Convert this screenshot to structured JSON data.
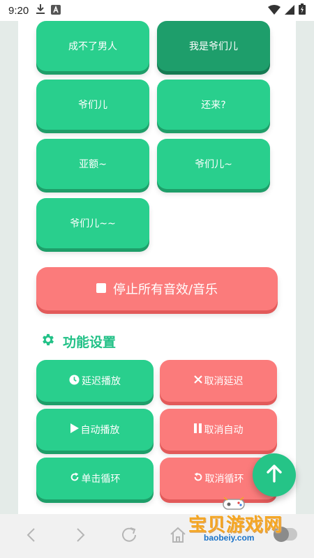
{
  "status_bar": {
    "time": "9:20",
    "icons": [
      "download-icon",
      "notification-a-icon",
      "wifi-icon",
      "signal-icon",
      "battery-icon"
    ]
  },
  "sound_buttons": [
    {
      "label": "成不了男人",
      "variant": "green"
    },
    {
      "label": "我是爷们儿",
      "variant": "green-dark"
    },
    {
      "label": "爷们儿",
      "variant": "green"
    },
    {
      "label": "还来?",
      "variant": "green"
    },
    {
      "label": "亚额~",
      "variant": "green"
    },
    {
      "label": "爷们儿~",
      "variant": "green"
    },
    {
      "label": "爷们儿~~",
      "variant": "green"
    }
  ],
  "stop_button": {
    "label": "停止所有音效/音乐",
    "icon": "stop-square-icon"
  },
  "settings_section": {
    "title": "功能设置",
    "icon": "gear-icon"
  },
  "function_buttons": [
    {
      "label": "延迟播放",
      "icon": "clock-icon",
      "variant": "green"
    },
    {
      "label": "取消延迟",
      "icon": "close-x-icon",
      "variant": "red"
    },
    {
      "label": "自动播放",
      "icon": "play-icon",
      "variant": "green"
    },
    {
      "label": "取消自动",
      "icon": "pause-icon",
      "variant": "red"
    },
    {
      "label": "单击循环",
      "icon": "redo-icon",
      "variant": "green"
    },
    {
      "label": "取消循环",
      "icon": "undo-icon",
      "variant": "red"
    }
  ],
  "scroll_top_button": {
    "icon": "arrow-up-icon"
  },
  "browser_nav": {
    "icons": [
      "back-icon",
      "forward-icon",
      "reload-icon",
      "home-icon"
    ]
  },
  "watermark": {
    "main_text": "宝贝游戏网",
    "sub_text": "baobeiy.com"
  },
  "colors": {
    "green": "#29cf8d",
    "green_dark": "#1e9e6b",
    "red": "#fb7b7b",
    "accent": "#22c187"
  }
}
